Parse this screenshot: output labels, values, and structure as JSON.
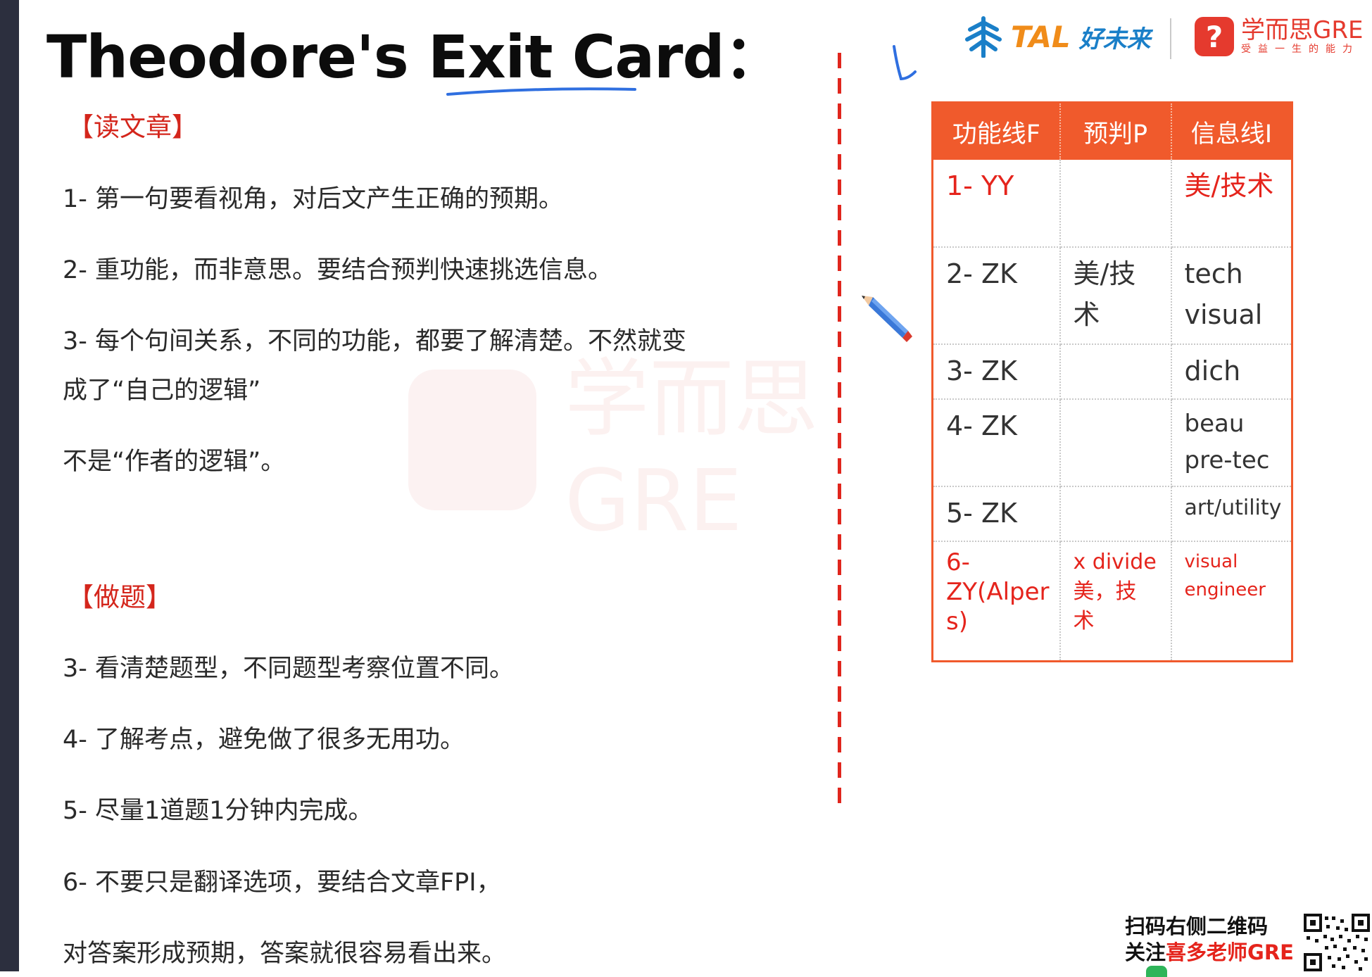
{
  "title": "Theodore's Exit Card：",
  "read_section": {
    "heading": "【读文章】",
    "items": [
      "1- 第一句要看视角，对后文产生正确的预期。",
      "2- 重功能，而非意思。要结合预判快速挑选信息。",
      "3- 每个句间关系，不同的功能，都要了解清楚。不然就变",
      "成了“自己的逻辑”",
      "不是“作者的逻辑”。"
    ]
  },
  "solve_section": {
    "heading": "【做题】",
    "items": [
      "3- 看清楚题型，不同题型考察位置不同。",
      "4- 了解考点，避免做了很多无用功。",
      "5- 尽量1道题1分钟内完成。",
      "6- 不要只是翻译选项，要结合文章FPI，",
      "对答案形成预期，答案就很容易看出来。"
    ]
  },
  "logos": {
    "tal_text": "TAL",
    "tal_cn": "好未来",
    "xes_main": "学而思GRE",
    "xes_sub": "受益一生的能力",
    "xes_glyph": "?"
  },
  "table": {
    "headers": [
      "功能线F",
      "预判P",
      "信息线I"
    ],
    "rows": [
      {
        "f": "1- YY",
        "p": "",
        "i": "美/技术"
      },
      {
        "f": "2- ZK",
        "p": "美/技术",
        "i": "tech\nvisual"
      },
      {
        "f": "3- ZK",
        "p": "",
        "i": "dich"
      },
      {
        "f": "4- ZK",
        "p": "",
        "i": "beau\npre-tec"
      },
      {
        "f": "5- ZK",
        "p": "",
        "i": "art/utility"
      },
      {
        "f": "6-\nZY(Alper\ns)",
        "p": "x divide\n美，技\n术",
        "i": "visual\nengineer"
      }
    ]
  },
  "promo": {
    "line1": "扫码右侧二维码",
    "line2_prefix": "关注",
    "line2_highlight": "喜多老师GRE"
  },
  "colors": {
    "accent_red": "#e5241c",
    "table_header": "#f05a2c",
    "ink_blue": "#2f6fe0",
    "side_bar": "#2c2f3e"
  },
  "icons": [
    "pencil-icon",
    "tal-tree-logo-icon",
    "xes-logo-icon",
    "qr-code-icon"
  ]
}
